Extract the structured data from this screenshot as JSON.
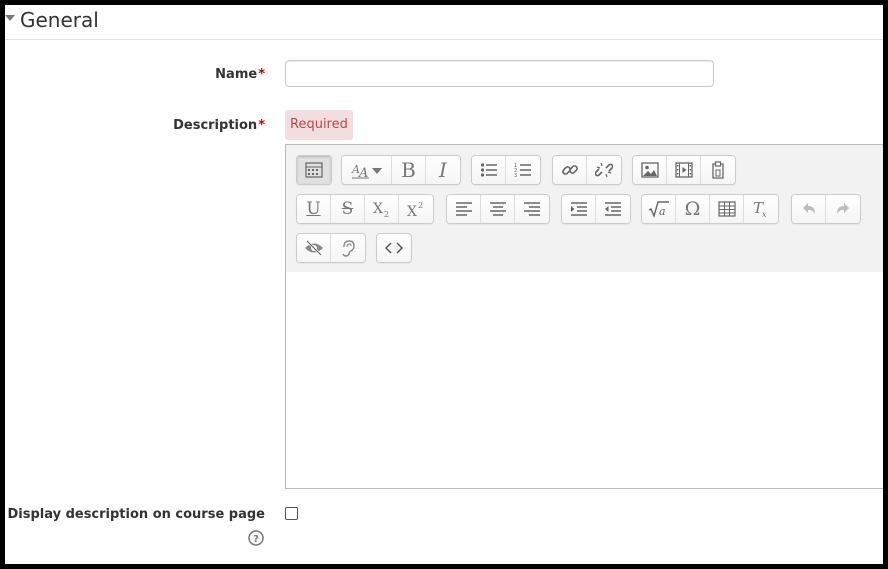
{
  "section": {
    "title": "General"
  },
  "fields": {
    "name": {
      "label": "Name",
      "required_mark": "*",
      "value": "",
      "placeholder": ""
    },
    "description": {
      "label": "Description",
      "required_mark": "*",
      "error_badge": "Required"
    },
    "display_description": {
      "label": "Display description on course page",
      "checked": false
    }
  },
  "toolbar": {
    "rows": [
      [
        [
          "toggle-toolbar"
        ],
        [
          "font-style",
          "bold",
          "italic"
        ],
        [
          "unordered-list",
          "ordered-list"
        ],
        [
          "link",
          "unlink"
        ],
        [
          "image",
          "media",
          "manage-files"
        ]
      ],
      [
        [
          "underline",
          "strikethrough",
          "subscript",
          "superscript"
        ],
        [
          "align-left",
          "align-center",
          "align-right"
        ],
        [
          "indent",
          "outdent"
        ],
        [
          "equation",
          "special-character",
          "table",
          "clear-formatting"
        ],
        [
          "undo",
          "redo"
        ]
      ],
      [
        [
          "accessibility-checker",
          "screenreader-helper"
        ],
        [
          "html-source"
        ]
      ]
    ]
  },
  "colors": {
    "required": "#cc0000",
    "badge_bg": "#f2dede",
    "badge_text": "#b94a48",
    "toolbar_bg": "#f2f2f2"
  }
}
